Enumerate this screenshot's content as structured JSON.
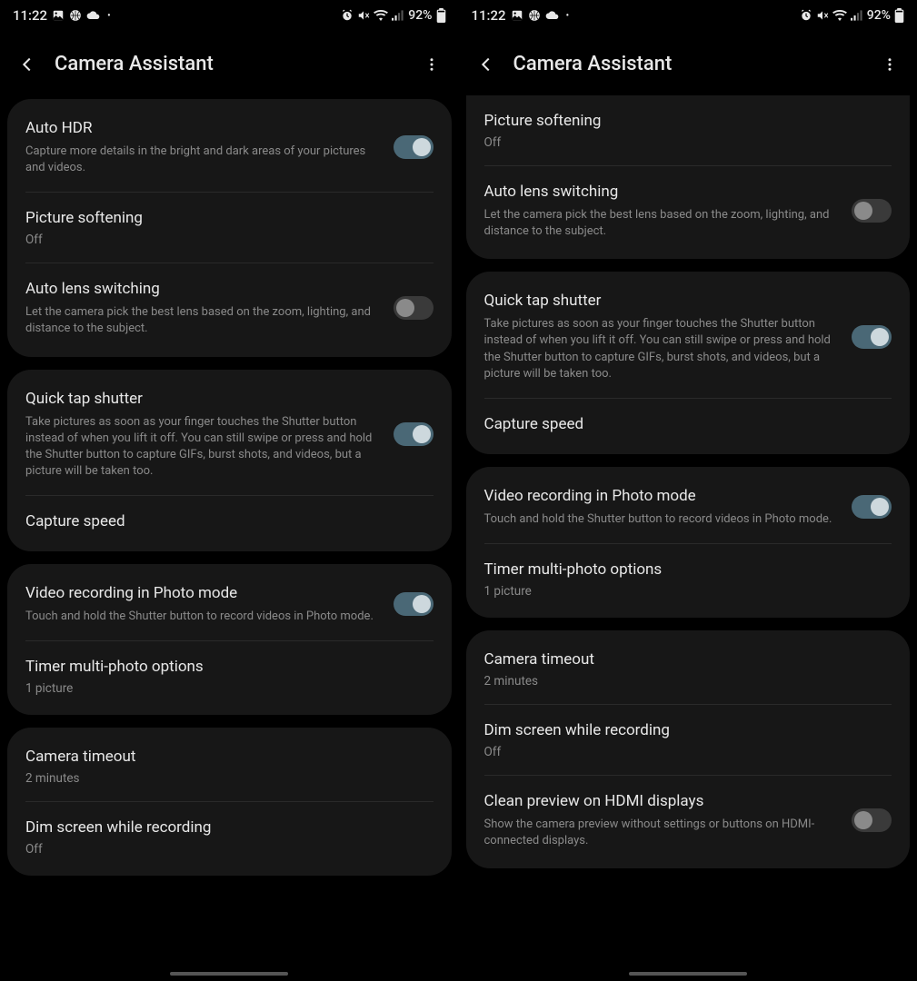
{
  "status": {
    "time": "11:22",
    "battery": "92%"
  },
  "header": {
    "title": "Camera Assistant"
  },
  "left": {
    "g1": {
      "r1": {
        "title": "Auto HDR",
        "desc": "Capture more details in the bright and dark areas of your pictures and videos."
      },
      "r2": {
        "title": "Picture softening",
        "sub": "Off"
      },
      "r3": {
        "title": "Auto lens switching",
        "desc": "Let the camera pick the best lens based on the zoom, lighting, and distance to the subject."
      }
    },
    "g2": {
      "r1": {
        "title": "Quick tap shutter",
        "desc": "Take pictures as soon as your finger touches the Shutter button instead of when you lift it off. You can still swipe or press and hold the Shutter button to capture GIFs, burst shots, and videos, but a picture will be taken too."
      },
      "r2": {
        "title": "Capture speed"
      }
    },
    "g3": {
      "r1": {
        "title": "Video recording in Photo mode",
        "desc": "Touch and hold the Shutter button to record videos in Photo mode."
      },
      "r2": {
        "title": "Timer multi-photo options",
        "sub": "1 picture"
      }
    },
    "g4": {
      "r1": {
        "title": "Camera timeout",
        "sub": "2 minutes"
      },
      "r2": {
        "title": "Dim screen while recording",
        "sub": "Off"
      }
    }
  },
  "right": {
    "g1": {
      "r1": {
        "title": "Picture softening",
        "sub": "Off"
      },
      "r2": {
        "title": "Auto lens switching",
        "desc": "Let the camera pick the best lens based on the zoom, lighting, and distance to the subject."
      }
    },
    "g2": {
      "r1": {
        "title": "Quick tap shutter",
        "desc": "Take pictures as soon as your finger touches the Shutter button instead of when you lift it off. You can still swipe or press and hold the Shutter button to capture GIFs, burst shots, and videos, but a picture will be taken too."
      },
      "r2": {
        "title": "Capture speed"
      }
    },
    "g3": {
      "r1": {
        "title": "Video recording in Photo mode",
        "desc": "Touch and hold the Shutter button to record videos in Photo mode."
      },
      "r2": {
        "title": "Timer multi-photo options",
        "sub": "1 picture"
      }
    },
    "g4": {
      "r1": {
        "title": "Camera timeout",
        "sub": "2 minutes"
      },
      "r2": {
        "title": "Dim screen while recording",
        "sub": "Off"
      },
      "r3": {
        "title": "Clean preview on HDMI displays",
        "desc": "Show the camera preview without settings or buttons on HDMI-connected displays."
      }
    }
  }
}
